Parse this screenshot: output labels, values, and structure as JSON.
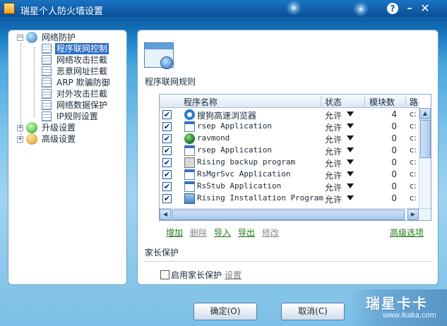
{
  "window": {
    "title": "瑞星个人防火墙设置",
    "help_label": "?",
    "minimize_label": "–",
    "close_label": "✕"
  },
  "tree": {
    "network": {
      "label": "网络防护",
      "expanded_glyph": "−",
      "children": [
        "程序联网控制",
        "网络攻击拦截",
        "恶意网址拦截",
        "ARP 欺骗防御",
        "对外攻击拦截",
        "网络数据保护",
        "IP规则设置"
      ]
    },
    "upgrade": {
      "label": "升级设置",
      "glyph": "+"
    },
    "advanced": {
      "label": "高级设置",
      "glyph": "+"
    },
    "selected": "程序联网控制"
  },
  "main": {
    "section_title": "程序联网规则",
    "table": {
      "headers": [
        "程序名称",
        "状态",
        "模块数",
        "路"
      ],
      "rows": [
        {
          "checked": true,
          "icon": "sogou-browser-icon",
          "name": "搜狗高速浏览器",
          "status": "允许",
          "count": "4",
          "path": "c:"
        },
        {
          "checked": true,
          "icon": "application-window-icon",
          "name": "rsep Application",
          "status": "允许",
          "count": "0",
          "path": "c:"
        },
        {
          "checked": true,
          "icon": "globe-icon",
          "name": "ravmond",
          "status": "允许",
          "count": "0",
          "path": "c:"
        },
        {
          "checked": true,
          "icon": "application-window-icon",
          "name": "rsep Application",
          "status": "允许",
          "count": "0",
          "path": "c:"
        },
        {
          "checked": true,
          "icon": "backup-program-icon",
          "name": "Rising backup program",
          "status": "允许",
          "count": "0",
          "path": "c:"
        },
        {
          "checked": true,
          "icon": "application-window-icon",
          "name": "RsMgrSvc Application",
          "status": "允许",
          "count": "0",
          "path": "c:"
        },
        {
          "checked": true,
          "icon": "application-window-icon",
          "name": "RsStub Application",
          "status": "允许",
          "count": "0",
          "path": "c:"
        },
        {
          "checked": true,
          "icon": "installer-icon",
          "name": "Rising Installation Program",
          "status": "允许",
          "count": "0",
          "path": "c:"
        }
      ],
      "check_glyph": "✔"
    },
    "actions": {
      "add": "增加",
      "delete": "删除",
      "import": "导入",
      "export": "导出",
      "modify": "修改",
      "advanced": "高级选项"
    },
    "parental": {
      "title": "家长保护",
      "enable_label": "启用家长保护",
      "settings_link": "设置"
    }
  },
  "buttons": {
    "ok": "确定(O)",
    "cancel": "取消(C)"
  },
  "brand": {
    "main": "瑞星卡卡",
    "sub": "www.ikaka.com"
  },
  "colors": {
    "accent": "#2d6fc6",
    "title_bar": "#0a4f97",
    "action_link": "#1a7a10",
    "disabled_link": "#8a8a8a"
  }
}
